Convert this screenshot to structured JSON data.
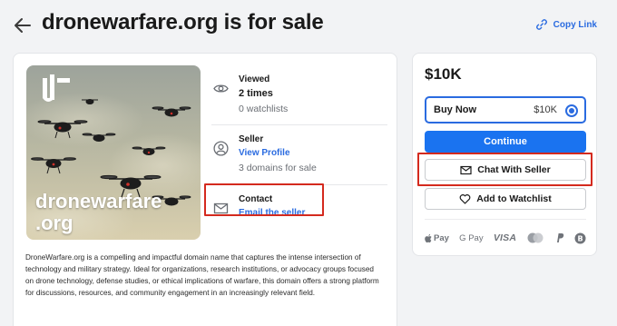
{
  "header": {
    "title": "dronewarfare.org is for sale",
    "copy_link_label": "Copy Link"
  },
  "image": {
    "domain_line1": "dronewarfare",
    "domain_line2": ".org"
  },
  "stats": {
    "viewed": {
      "title": "Viewed",
      "value": "2 times",
      "sub": "0 watchlists"
    },
    "seller": {
      "title": "Seller",
      "link": "View Profile",
      "sub": "3 domains for sale"
    },
    "contact": {
      "title": "Contact",
      "link": "Email the seller"
    }
  },
  "description": "DroneWarfare.org is a compelling and impactful domain name that captures the intense intersection of technology and military strategy. Ideal for organizations, research institutions, or advocacy groups focused on drone technology, defense studies, or ethical implications of warfare, this domain offers a strong platform for discussions, resources, and community engagement in an increasingly relevant field.",
  "purchase": {
    "price": "$10K",
    "option_label": "Buy Now",
    "option_price": "$10K",
    "continue_label": "Continue",
    "chat_label": "Chat With Seller",
    "watchlist_label": "Add to Watchlist",
    "payment_methods": {
      "apple_pay": "Pay",
      "google_pay": "G Pay",
      "visa": "VISA"
    }
  },
  "colors": {
    "accent": "#1a73f0",
    "link": "#2a6be0",
    "highlight": "#d42a1e"
  }
}
